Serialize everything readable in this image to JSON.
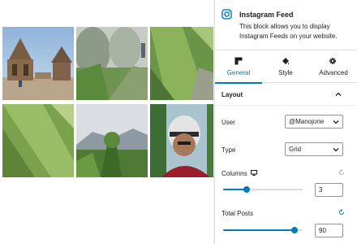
{
  "block": {
    "title": "Instagram Feed",
    "description": "This block allows you to display Instagram Feeds on your website.",
    "icon": "instagram-icon"
  },
  "tabs": [
    {
      "label": "General",
      "icon": "general-tab-icon",
      "active": true
    },
    {
      "label": "Style",
      "icon": "paint-bucket-icon",
      "active": false
    },
    {
      "label": "Advanced",
      "icon": "gear-icon",
      "active": false
    }
  ],
  "layout": {
    "section_title": "Layout",
    "user": {
      "label": "User",
      "value": "@Manojone"
    },
    "type": {
      "label": "Type",
      "value": "Grid"
    },
    "columns": {
      "label": "Columns",
      "value": "3",
      "slider_fraction": 0.3
    },
    "total_posts": {
      "label": "Total Posts",
      "value": "90",
      "slider_fraction": 0.9
    }
  },
  "grid": {
    "photos": [
      {
        "name": "temple-photo"
      },
      {
        "name": "misty-forest-photo"
      },
      {
        "name": "blurred-greenery-photo"
      },
      {
        "name": "blurred-grass-photo"
      },
      {
        "name": "mountain-valley-photo"
      },
      {
        "name": "helmet-selfie-photo"
      }
    ]
  },
  "colors": {
    "accent": "#007cba",
    "text": "#1e1e1e",
    "border": "#e0e0e0"
  }
}
